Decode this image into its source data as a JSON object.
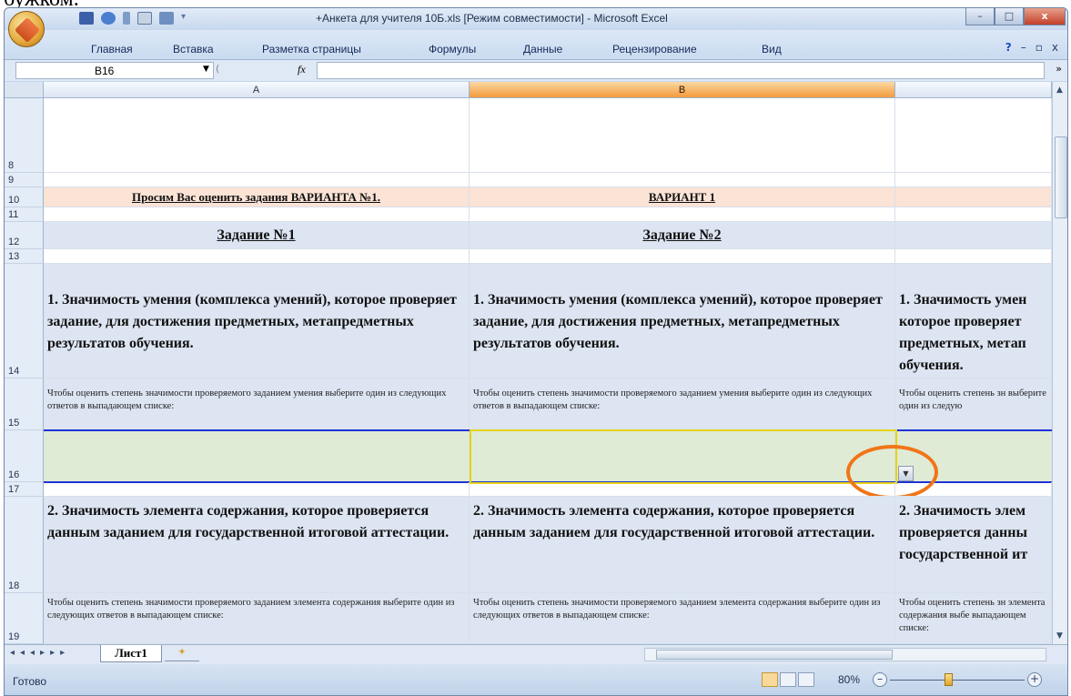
{
  "top_fragment": "бужком.",
  "window": {
    "title": "+Анкета для учителя 10Б.xls [Режим совместимости] - Microsoft Excel",
    "buttons": {
      "minimize": "–",
      "maximize": "□",
      "close": "x"
    }
  },
  "ribbon": {
    "tabs": [
      "Главная",
      "Вставка",
      "Разметка страницы",
      "Формулы",
      "Данные",
      "Рецензирование",
      "Вид"
    ],
    "right_icons": [
      "help-icon",
      "minimize",
      "restore",
      "close"
    ]
  },
  "formula_bar": {
    "name_box": "B16",
    "fx": "fx",
    "value": ""
  },
  "columns": {
    "a": "A",
    "b": "B"
  },
  "rows": [
    "8",
    "9",
    "10",
    "11",
    "12",
    "13",
    "14",
    "15",
    "16",
    "17",
    "18",
    "19"
  ],
  "sheet": {
    "row10": {
      "a": "Просим Вас оценить задания ВАРИАНТА №1.",
      "b": "ВАРИАНТ 1"
    },
    "row12": {
      "a": "Задание №1",
      "b": "Задание №2"
    },
    "row14": {
      "a": "1. Значимость умения (комплекса умений), которое проверяет задание, для достижения предметных, метапредметных результатов обучения.",
      "b": "1. Значимость умения (комплекса умений), которое проверяет задание, для достижения предметных, метапредметных результатов обучения.",
      "c": "1. Значимость умен которое проверяет предметных, метап обучения."
    },
    "row15": {
      "a": "Чтобы оценить степень значимости проверяемого заданием умения выберите один из следующих ответов в выпадающем списке:",
      "b": "Чтобы оценить степень значимости проверяемого заданием умения выберите один из следующих ответов в выпадающем списке:",
      "c": "Чтобы оценить степень зн выберите один из следую"
    },
    "row18": {
      "a": "2. Значимость элемента содержания, которое проверяется данным заданием для государственной итоговой аттестации.",
      "b": "2. Значимость элемента содержания, которое проверяется данным заданием для государственной итоговой аттестации.",
      "c": "2. Значимость элем проверяется данны государственной ит"
    },
    "row19": {
      "a": "Чтобы оценить степень значимости проверяемого заданием элемента содержания выберите один из следующих ответов в выпадающем списке:",
      "b": "Чтобы оценить степень значимости проверяемого заданием элемента содержания выберите один из следующих ответов в выпадающем списке:",
      "c": "Чтобы оценить степень зн элемента содержания выбе выпадающем списке:"
    }
  },
  "sheet_tabs": {
    "active": "Лист1"
  },
  "status_bar": {
    "status": "Готово",
    "zoom": "80%",
    "minus": "–",
    "plus": "+"
  },
  "colors": {
    "accent": "#f07518",
    "selection": "#e7d318",
    "row_blue": "#dde5f2",
    "row_green": "#e0ebd5",
    "row_peach": "#fbe3d6"
  }
}
